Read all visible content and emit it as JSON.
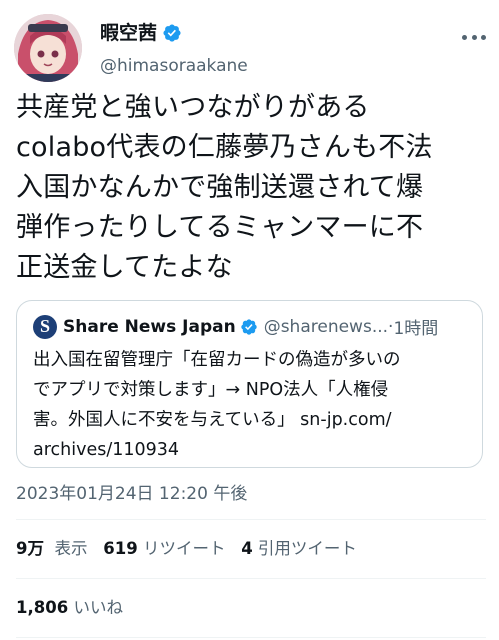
{
  "author": {
    "display_name": "暇空茜",
    "handle": "@himasoraakane"
  },
  "tweet": {
    "text": "共産党と強いつながりがある\ncolabo代表の仁藤夢乃さんも不法\n入国かなんかで強制送還されて爆\n弾作ったりしてるミャンマーに不\n正送金してたよな"
  },
  "quote": {
    "logo_letter": "S",
    "name": "Share News Japan",
    "handle": "@sharenews...",
    "separator": " · ",
    "time": "1時間",
    "text": "出入国在留管理庁「在留カードの偽造が多いの\nでアプリで対策します」→ NPO法人「人権侵\n害。外国人に不安を与えている」 sn-jp.com/\narchives/110934"
  },
  "timestamp": "2023年01月24日 12:20 午後",
  "stats": {
    "views_count": "9万",
    "views_label": "表示",
    "retweets_count": "619",
    "retweets_label": "リツイート",
    "quotes_count": "4",
    "quotes_label": "引用ツイート",
    "likes_count": "1,806",
    "likes_label": "いいね"
  },
  "colors": {
    "verified": "#1d9bf0",
    "secondary_text": "#536471",
    "border": "#cfd9de"
  },
  "icons": {
    "verified": "verified-badge-icon",
    "more": "more-dots-icon"
  }
}
